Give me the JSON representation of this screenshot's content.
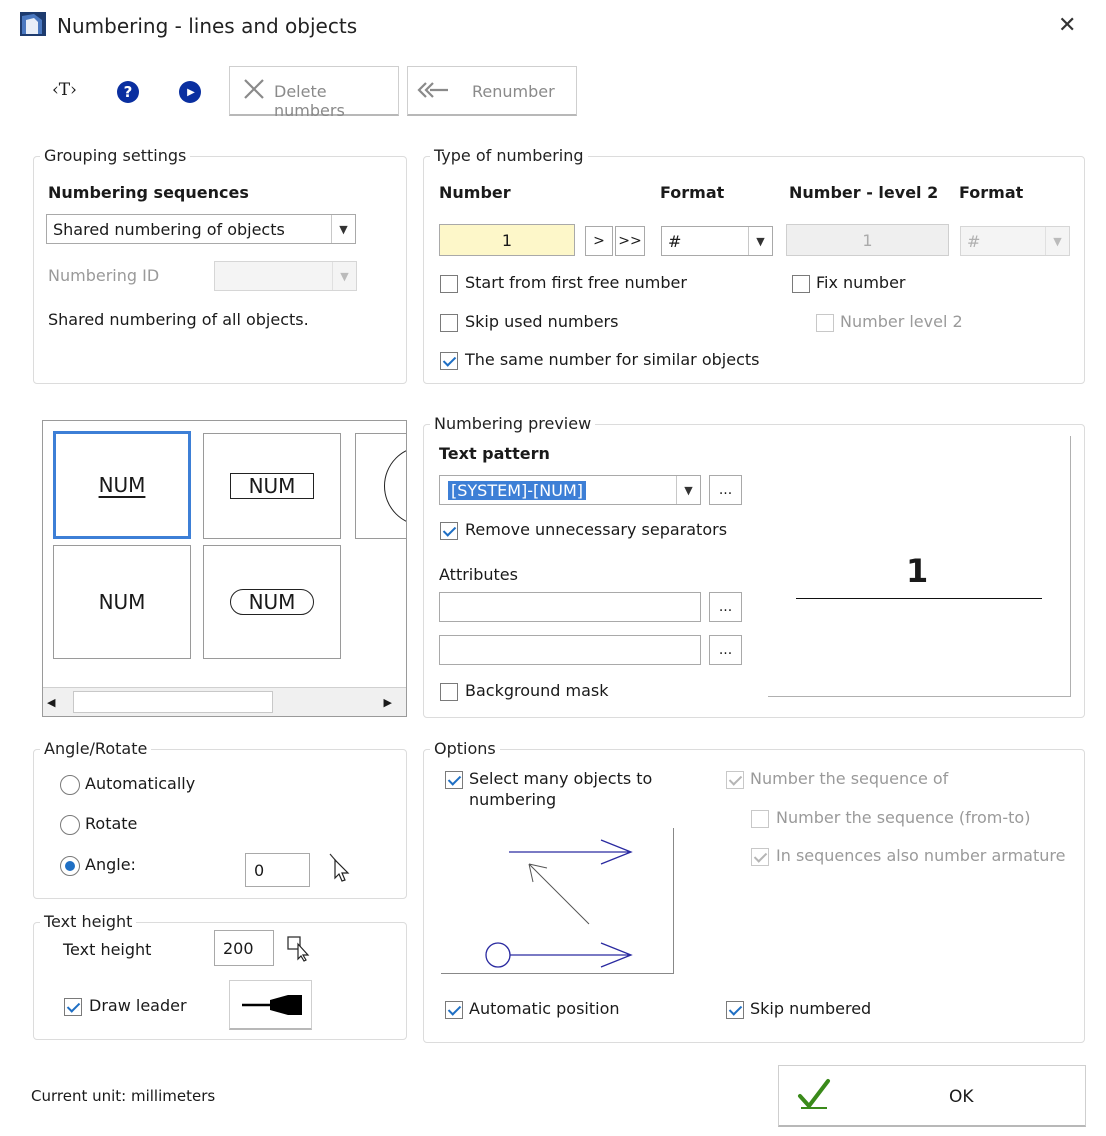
{
  "window": {
    "title": "Numbering - lines and objects",
    "close_glyph": "✕"
  },
  "toolbar": {
    "text_tool_label": "‹T›",
    "help_glyph": "?",
    "play_glyph": "▶",
    "delete_label": "Delete numbers",
    "renumber_label": "Renumber"
  },
  "grouping": {
    "legend": "Grouping settings",
    "sequences_heading": "Numbering sequences",
    "sequence_value": "Shared numbering of objects",
    "numbering_id_label": "Numbering ID",
    "numbering_id_value": "",
    "description": "Shared numbering of all objects."
  },
  "type_of_numbering": {
    "legend": "Type of numbering",
    "number_heading": "Number",
    "format_heading": "Format",
    "number_level2_heading": "Number - level 2",
    "format2_heading": "Format",
    "number_value": "1",
    "next_button": ">",
    "next_all_button": ">>",
    "format_value": "#",
    "number_level2_value": "1",
    "format2_value": "#",
    "start_first_free": "Start from first free number",
    "fix_number": "Fix number",
    "skip_used": "Skip used numbers",
    "number_level2_check": "Number level 2",
    "same_number": "The same number for similar objects"
  },
  "styles": {
    "tiles": [
      "NUM",
      "NUM",
      "NUM",
      "NUM"
    ]
  },
  "preview": {
    "legend": "Numbering preview",
    "text_pattern_heading": "Text pattern",
    "text_pattern_value": "[SYSTEM]-[NUM]",
    "ellipsis": "...",
    "remove_separators": "Remove unnecessary separators",
    "attributes_label": "Attributes",
    "attribute1": "",
    "attribute2": "",
    "background_mask": "Background mask",
    "preview_number": "1"
  },
  "angle": {
    "legend": "Angle/Rotate",
    "automatically": "Automatically",
    "rotate": "Rotate",
    "angle_label": "Angle:",
    "angle_value": "0"
  },
  "text_height": {
    "legend": "Text height",
    "label": "Text height",
    "value": "200",
    "draw_leader": "Draw leader"
  },
  "options": {
    "legend": "Options",
    "select_many_line1": "Select many objects to",
    "select_many_line2": "numbering",
    "number_sequence_of": "Number the sequence of",
    "number_sequence_from_to": "Number the sequence (from-to)",
    "in_sequences_armature": "In sequences also number armature",
    "automatic_position": "Automatic position",
    "skip_numbered": "Skip numbered"
  },
  "footer": {
    "current_unit": "Current unit: millimeters",
    "ok_label": "OK"
  },
  "colors": {
    "accent": "#1f6fc4",
    "highlight_input": "#fdf7c9",
    "selection": "#3d7fd6"
  }
}
